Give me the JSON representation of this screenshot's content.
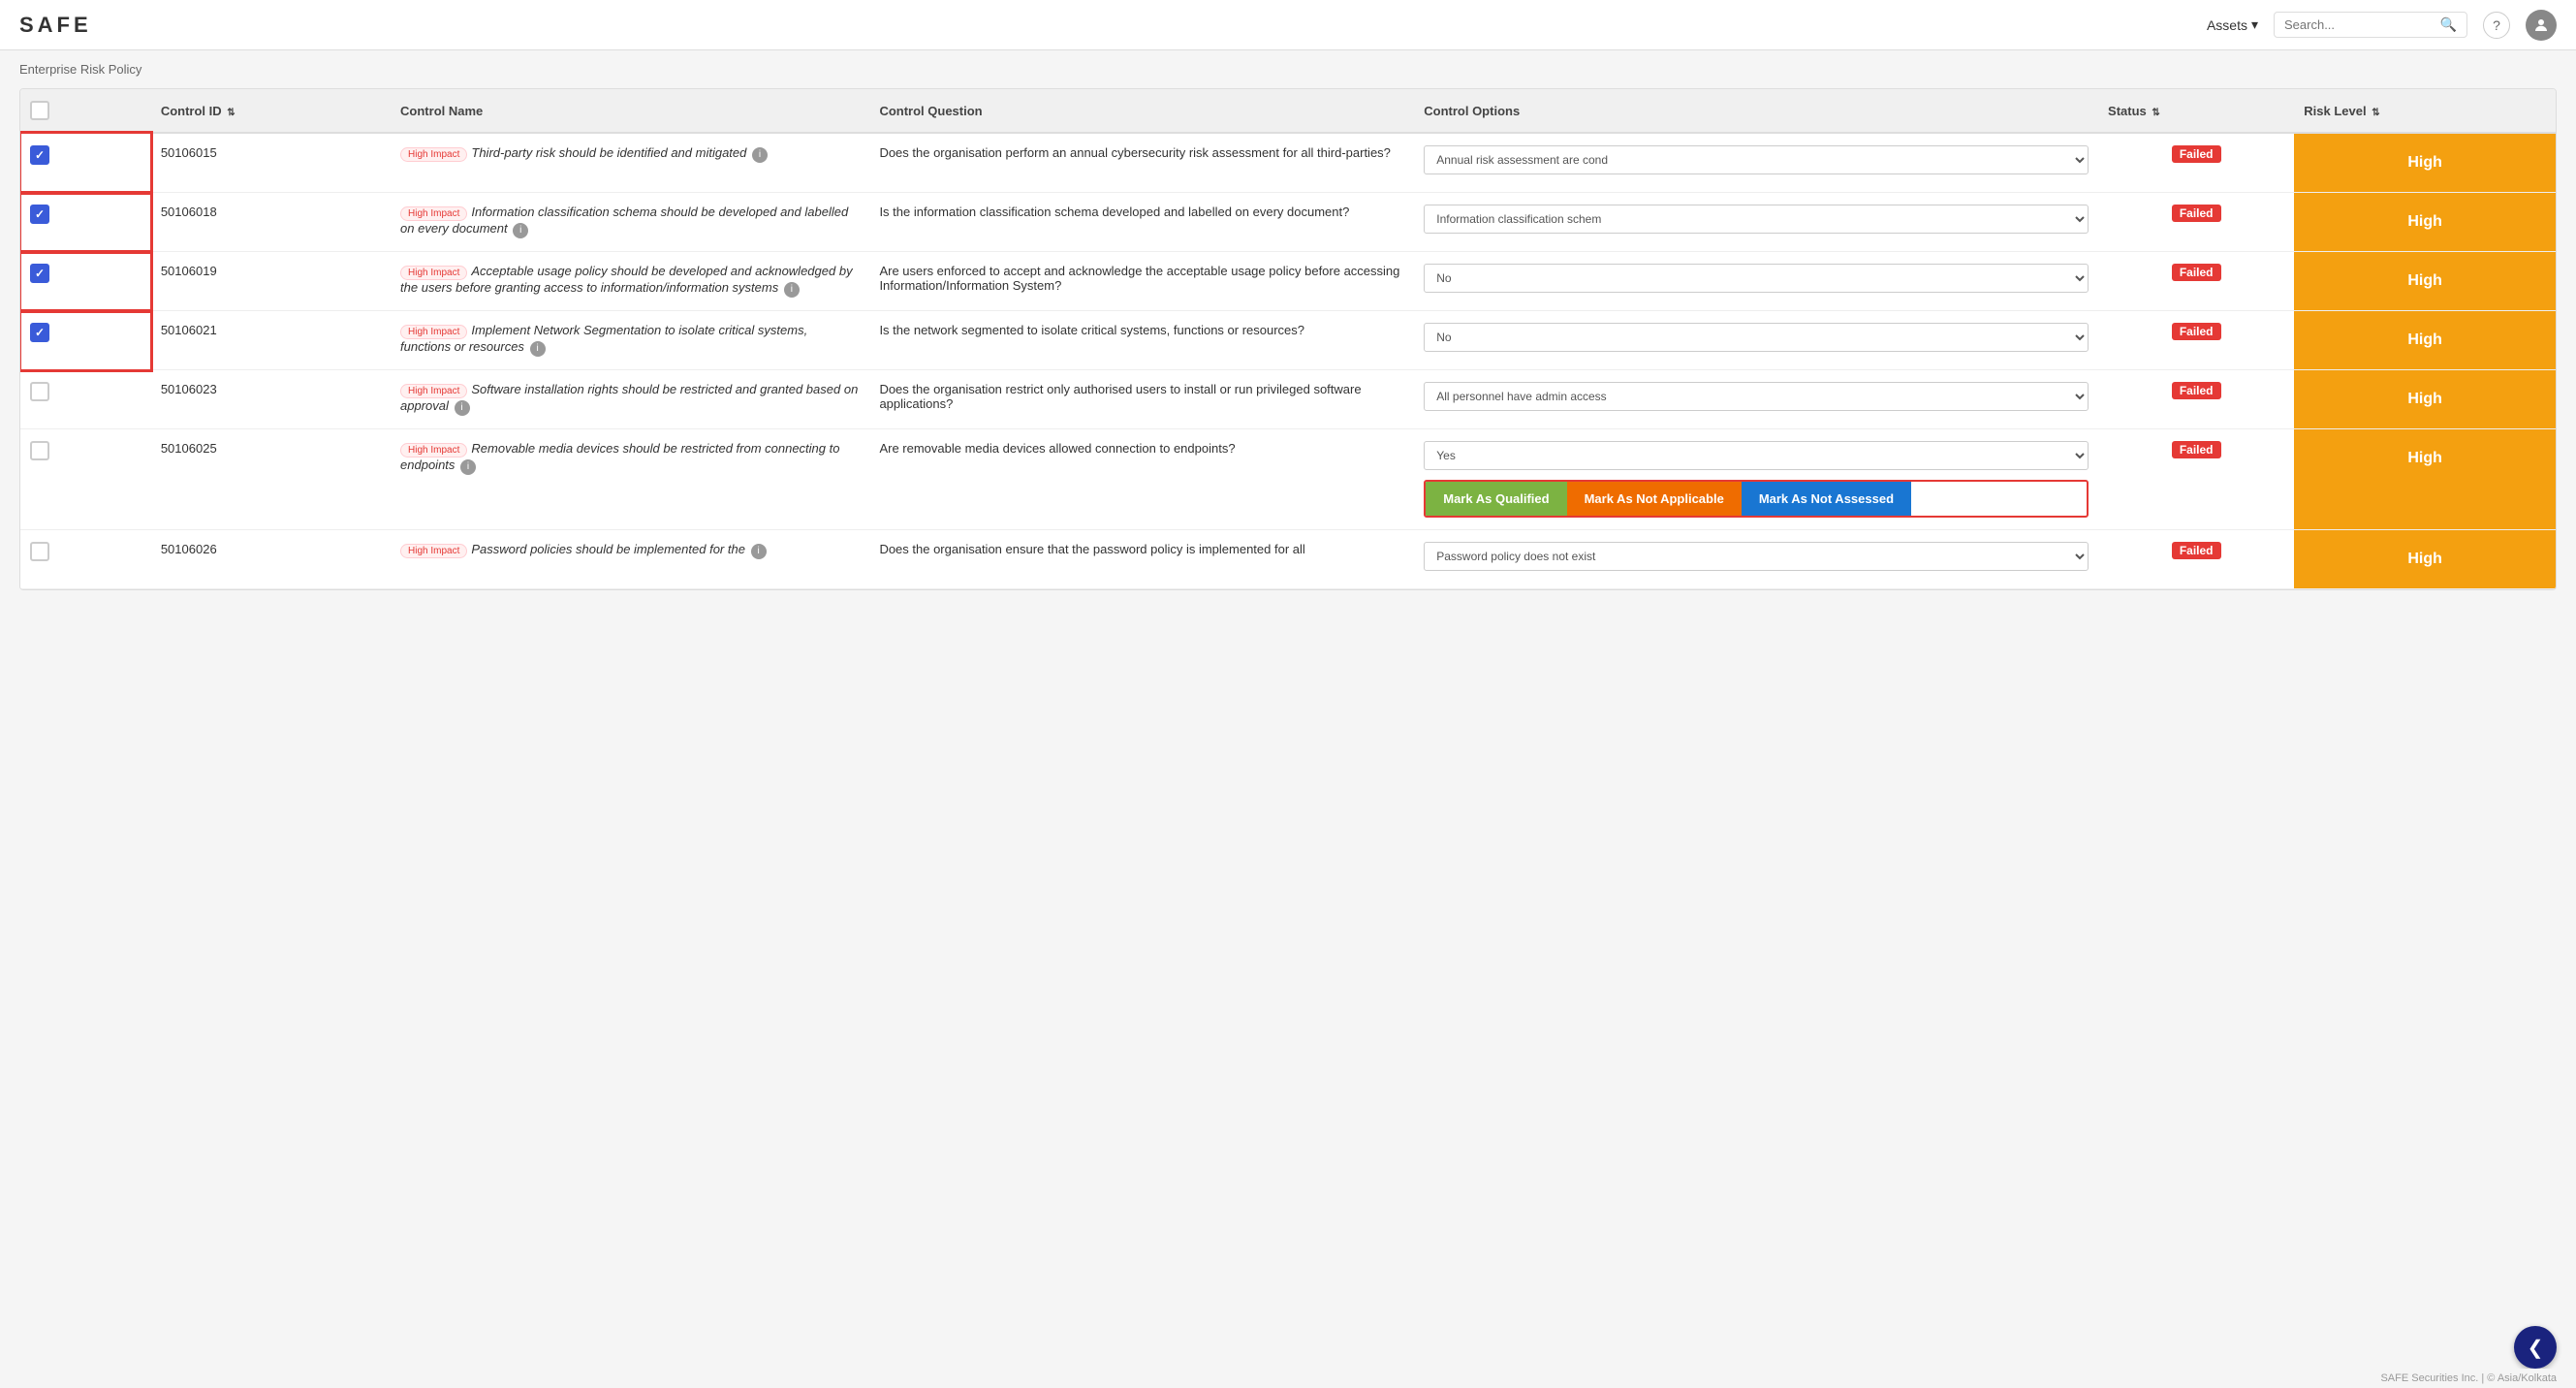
{
  "header": {
    "logo": "SAFE",
    "assets_label": "Assets",
    "search_placeholder": "Search...",
    "help_icon": "?",
    "avatar_icon": "👤"
  },
  "breadcrumb": {
    "text": "Enterprise Risk Policy"
  },
  "table": {
    "columns": [
      {
        "key": "checkbox",
        "label": ""
      },
      {
        "key": "control_id",
        "label": "Control ID"
      },
      {
        "key": "control_name",
        "label": "Control Name"
      },
      {
        "key": "control_question",
        "label": "Control Question"
      },
      {
        "key": "control_options",
        "label": "Control Options"
      },
      {
        "key": "status",
        "label": "Status"
      },
      {
        "key": "risk_level",
        "label": "Risk Level"
      }
    ],
    "rows": [
      {
        "id": "row1",
        "checked": true,
        "control_id": "50106015",
        "badge": "High Impact",
        "control_name": "Third-party risk should be identified and mitigated",
        "control_question": "Does the organisation perform an annual cybersecurity risk assessment for all third-parties?",
        "control_option_value": "Annual risk assessment are cond",
        "status": "Failed",
        "risk_level": "High"
      },
      {
        "id": "row2",
        "checked": true,
        "control_id": "50106018",
        "badge": "High Impact",
        "control_name": "Information classification schema should be developed and labelled on every document",
        "control_question": "Is the information classification schema developed and labelled on every document?",
        "control_option_value": "Information classification schem",
        "status": "Failed",
        "risk_level": "High"
      },
      {
        "id": "row3",
        "checked": true,
        "control_id": "50106019",
        "badge": "High Impact",
        "control_name": "Acceptable usage policy should be developed and acknowledged by the users before granting access to information/information systems",
        "control_question": "Are users enforced to accept and acknowledge the acceptable usage policy before accessing Information/Information System?",
        "control_option_value": "No",
        "status": "Failed",
        "risk_level": "High"
      },
      {
        "id": "row4",
        "checked": true,
        "control_id": "50106021",
        "badge": "High Impact",
        "control_name": "Implement Network Segmentation to isolate critical systems, functions or resources",
        "control_question": "Is the network segmented to isolate critical systems, functions or resources?",
        "control_option_value": "No",
        "status": "Failed",
        "risk_level": "High"
      },
      {
        "id": "row5",
        "checked": false,
        "control_id": "50106023",
        "badge": "High Impact",
        "control_name": "Software installation rights should be restricted and granted based on approval",
        "control_question": "Does the organisation restrict only authorised users to install or run privileged software applications?",
        "control_option_value": "All personnel have admin access",
        "status": "Failed",
        "risk_level": "High"
      },
      {
        "id": "row6",
        "checked": false,
        "control_id": "50106025",
        "badge": "High Impact",
        "control_name": "Removable media devices should be restricted from connecting to endpoints",
        "control_question": "Are removable media devices allowed connection to endpoints?",
        "control_option_value": "Yes",
        "status": "Failed",
        "risk_level": "High",
        "has_action_buttons": true
      },
      {
        "id": "row7",
        "checked": false,
        "control_id": "50106026",
        "badge": "High Impact",
        "control_name": "Password policies should be implemented for the",
        "control_question": "Does the organisation ensure that the password policy is implemented for all",
        "control_option_value": "Password policy does not exist",
        "status": "Failed",
        "risk_level": "High"
      }
    ]
  },
  "action_buttons": {
    "qualified_label": "Mark As Qualified",
    "not_applicable_label": "Mark As Not Applicable",
    "not_assessed_label": "Mark As Not Assessed"
  },
  "footer": {
    "text": "SAFE Securities Inc. | © Asia/Kolkata"
  }
}
